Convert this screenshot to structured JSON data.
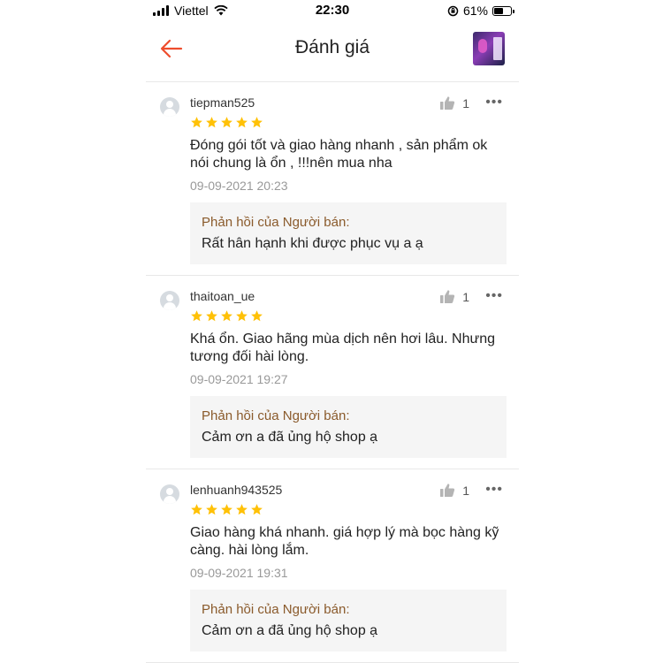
{
  "status_bar": {
    "carrier": "Viettel",
    "time": "22:30",
    "battery": "61%",
    "battery_level": 0.61
  },
  "header": {
    "title": "Đánh giá"
  },
  "reviews": [
    {
      "username": "tiepman525",
      "likes": "1",
      "rating": 5,
      "comment": "Đóng gói tốt và giao hàng nhanh , sản phẩm ok nói chung là ổn , !!!nên mua nha",
      "date": "09-09-2021 20:23",
      "reply_label": "Phản hồi của Người bán:",
      "reply_text": "Rất hân hạnh khi được phục vụ a ạ"
    },
    {
      "username": "thaitoan_ue",
      "likes": "1",
      "rating": 5,
      "comment": "Khá ổn. Giao hãng mùa dịch nên hơi lâu. Nhưng tương đối hài lòng.",
      "date": "09-09-2021 19:27",
      "reply_label": "Phản hồi của Người bán:",
      "reply_text": "Cảm ơn a đã ủng hộ shop ạ"
    },
    {
      "username": "lenhuanh943525",
      "likes": "1",
      "rating": 5,
      "comment": "Giao hàng khá nhanh. giá hợp lý mà bọc hàng kỹ càng. hài lòng lắm.",
      "date": "09-09-2021 19:31",
      "reply_label": "Phản hồi của Người bán:",
      "reply_text": "Cảm ơn a đã ủng hộ shop ạ"
    }
  ],
  "colors": {
    "accent": "#ee4d2d",
    "star": "#ffc107",
    "reply_label": "#8a5a2b"
  },
  "icons": {
    "back": "arrow-left-icon",
    "like": "thumbs-up-icon",
    "more": "more-dots-icon",
    "star": "star-icon"
  }
}
